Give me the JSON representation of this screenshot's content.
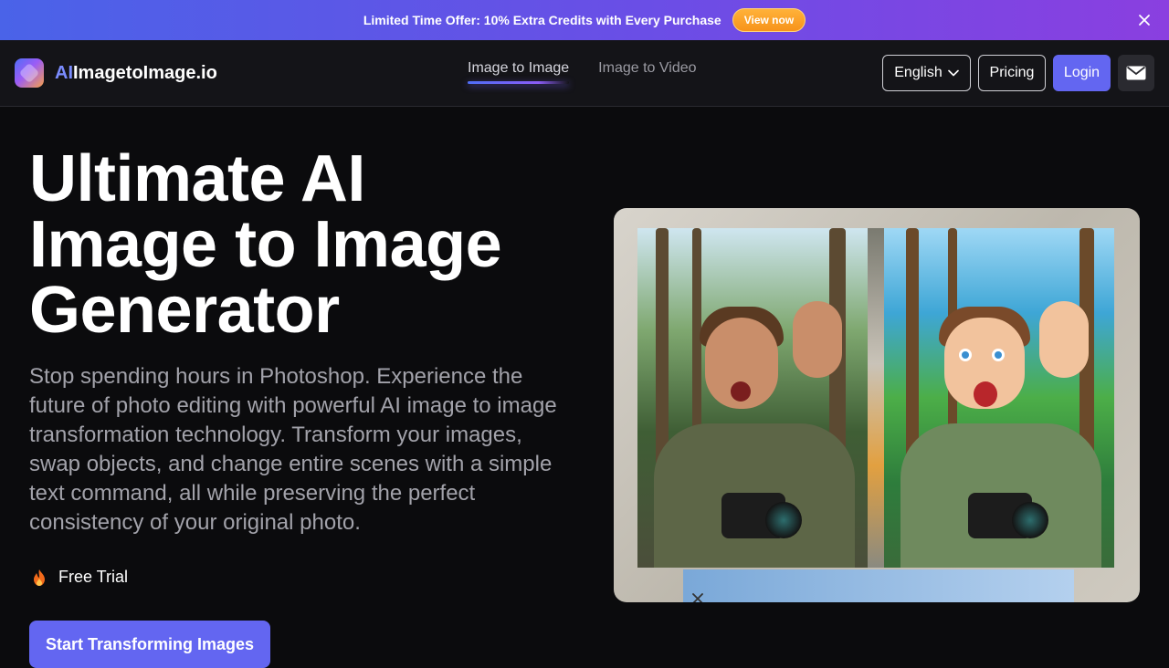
{
  "promo": {
    "text": "Limited Time Offer: 10% Extra Credits with Every Purchase",
    "button_label": "View now"
  },
  "header": {
    "logo_ai": "AI",
    "logo_rest": "ImagetoImage.io",
    "nav": [
      {
        "label": "Image to Image",
        "active": true
      },
      {
        "label": "Image to Video",
        "active": false
      }
    ],
    "language": "English",
    "pricing_label": "Pricing",
    "login_label": "Login"
  },
  "hero": {
    "title_lines": [
      "Ultimate AI",
      "Image to Image",
      "Generator"
    ],
    "description": "Stop spending hours in Photoshop. Experience the future of photo editing with powerful AI image to image transformation technology. Transform your images, swap objects, and change entire scenes with a simple text command, all while preserving the perfect consistency of your original photo.",
    "badge": "Free Trial",
    "cta_label": "Start Transforming Images"
  },
  "colors": {
    "accent": "#6366f1",
    "promo_button": "#f7931a",
    "background": "#0b0b0d"
  },
  "icons": {
    "promo_close": "close-icon",
    "language_chevron": "chevron-down-icon",
    "mail": "mail-icon",
    "badge": "flame-icon"
  }
}
